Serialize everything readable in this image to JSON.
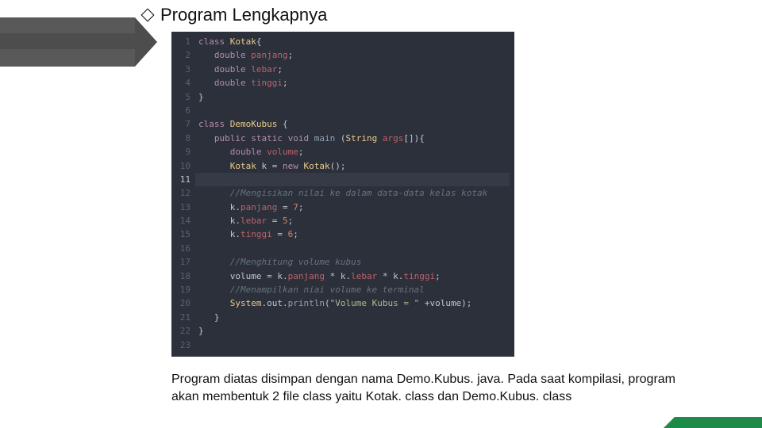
{
  "heading": "Program Lengkapnya",
  "caption": "Program diatas disimpan dengan nama Demo.Kubus. java. Pada saat kompilasi, program akan membentuk 2 file class yaitu Kotak. class dan Demo.Kubus. class",
  "code": {
    "active_line": 11,
    "lines": [
      {
        "n": 1,
        "tokens": [
          [
            "kw",
            "class "
          ],
          [
            "cls",
            "Kotak"
          ],
          [
            "pun",
            "{"
          ]
        ]
      },
      {
        "n": 2,
        "tokens": [
          [
            "pun",
            "   "
          ],
          [
            "type",
            "double"
          ],
          [
            "pun",
            " "
          ],
          [
            "varr",
            "panjang"
          ],
          [
            "pun",
            ";"
          ]
        ]
      },
      {
        "n": 3,
        "tokens": [
          [
            "pun",
            "   "
          ],
          [
            "type",
            "double"
          ],
          [
            "pun",
            " "
          ],
          [
            "varr",
            "lebar"
          ],
          [
            "pun",
            ";"
          ]
        ]
      },
      {
        "n": 4,
        "tokens": [
          [
            "pun",
            "   "
          ],
          [
            "type",
            "double"
          ],
          [
            "pun",
            " "
          ],
          [
            "varr",
            "tinggi"
          ],
          [
            "pun",
            ";"
          ]
        ]
      },
      {
        "n": 5,
        "tokens": [
          [
            "pun",
            "}"
          ]
        ]
      },
      {
        "n": 6,
        "tokens": []
      },
      {
        "n": 7,
        "tokens": [
          [
            "kw",
            "class "
          ],
          [
            "cls",
            "DemoKubus"
          ],
          [
            "pun",
            " {"
          ]
        ]
      },
      {
        "n": 8,
        "tokens": [
          [
            "pun",
            "   "
          ],
          [
            "kw",
            "public static "
          ],
          [
            "type",
            "void"
          ],
          [
            "pun",
            " "
          ],
          [
            "fn",
            "main"
          ],
          [
            "pun",
            " ("
          ],
          [
            "cls",
            "String"
          ],
          [
            "pun",
            " "
          ],
          [
            "varr",
            "args"
          ],
          [
            "pun",
            "[]){"
          ]
        ]
      },
      {
        "n": 9,
        "tokens": [
          [
            "pun",
            "      "
          ],
          [
            "type",
            "double"
          ],
          [
            "pun",
            " "
          ],
          [
            "varr",
            "volume"
          ],
          [
            "pun",
            ";"
          ]
        ]
      },
      {
        "n": 10,
        "tokens": [
          [
            "pun",
            "      "
          ],
          [
            "cls",
            "Kotak"
          ],
          [
            "pun",
            " k = "
          ],
          [
            "kw",
            "new"
          ],
          [
            "pun",
            " "
          ],
          [
            "cls",
            "Kotak"
          ],
          [
            "pun",
            "();"
          ]
        ]
      },
      {
        "n": 11,
        "tokens": []
      },
      {
        "n": 12,
        "tokens": [
          [
            "pun",
            "      "
          ],
          [
            "com",
            "//Mengisikan nilai ke dalam data-data kelas kotak"
          ]
        ]
      },
      {
        "n": 13,
        "tokens": [
          [
            "pun",
            "      k."
          ],
          [
            "varr",
            "panjang"
          ],
          [
            "pun",
            " = "
          ],
          [
            "num",
            "7"
          ],
          [
            "pun",
            ";"
          ]
        ]
      },
      {
        "n": 14,
        "tokens": [
          [
            "pun",
            "      k."
          ],
          [
            "varr",
            "lebar"
          ],
          [
            "pun",
            " = "
          ],
          [
            "num",
            "5"
          ],
          [
            "pun",
            ";"
          ]
        ]
      },
      {
        "n": 15,
        "tokens": [
          [
            "pun",
            "      k."
          ],
          [
            "varr",
            "tinggi"
          ],
          [
            "pun",
            " = "
          ],
          [
            "num",
            "6"
          ],
          [
            "pun",
            ";"
          ]
        ]
      },
      {
        "n": 16,
        "tokens": []
      },
      {
        "n": 17,
        "tokens": [
          [
            "pun",
            "      "
          ],
          [
            "com",
            "//Menghitung volume kubus"
          ]
        ]
      },
      {
        "n": 18,
        "tokens": [
          [
            "pun",
            "      volume = k."
          ],
          [
            "varr",
            "panjang"
          ],
          [
            "pun",
            " * k."
          ],
          [
            "varr",
            "lebar"
          ],
          [
            "pun",
            " * k."
          ],
          [
            "varr",
            "tinggi"
          ],
          [
            "pun",
            ";"
          ]
        ]
      },
      {
        "n": 19,
        "tokens": [
          [
            "pun",
            "      "
          ],
          [
            "com",
            "//Menampilkan niai volume ke terminal"
          ]
        ]
      },
      {
        "n": 20,
        "tokens": [
          [
            "pun",
            "      "
          ],
          [
            "cls",
            "System"
          ],
          [
            "pun",
            ".out."
          ],
          [
            "fn",
            "println"
          ],
          [
            "pun",
            "("
          ],
          [
            "str",
            "\"Volume Kubus = \""
          ],
          [
            "pun",
            " +volume);"
          ]
        ]
      },
      {
        "n": 21,
        "tokens": [
          [
            "pun",
            "   }"
          ]
        ]
      },
      {
        "n": 22,
        "tokens": [
          [
            "pun",
            "}"
          ]
        ]
      },
      {
        "n": 23,
        "tokens": []
      }
    ]
  }
}
